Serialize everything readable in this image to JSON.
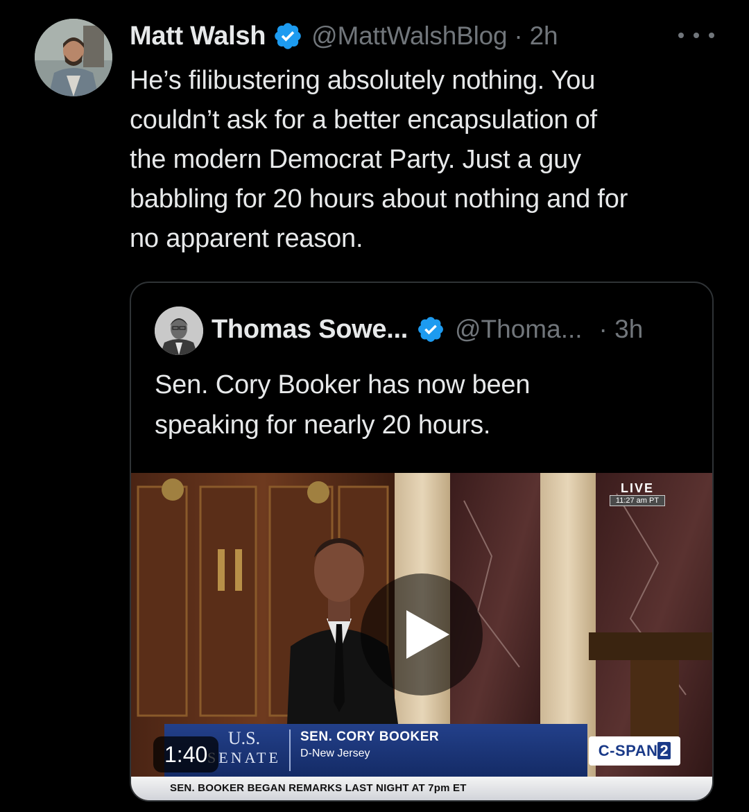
{
  "tweet": {
    "author_name": "Matt Walsh",
    "verified_icon": "verified-badge-icon",
    "handle_time": "@MattWalshBlog · 2h",
    "more_icon": "more-horizontal-icon",
    "body_lines": [
      "He’s filibustering absolutely nothing. You",
      "couldn’t ask for a better encapsulation of",
      "the modern Democrat Party. Just a guy",
      "babbling for 20 hours about nothing and for",
      "no apparent reason."
    ]
  },
  "quote": {
    "author_name": "Thomas Sowe...",
    "verified_icon": "verified-badge-icon",
    "handle": "@Thoma...",
    "time": "· 3h",
    "body_lines": [
      "Sen. Cory Booker has now been",
      "speaking for nearly 20 hours."
    ],
    "video": {
      "live_label": "LIVE",
      "live_time": "11:27 am PT",
      "senate_logo_top": "U.S.",
      "senate_logo_bottom": "SENATE",
      "lower_third_name": "SEN. CORY BOOKER",
      "lower_third_party": "D-New Jersey",
      "ticker": "SEN. BOOKER BEGAN REMARKS LAST NIGHT AT 7pm ET",
      "network_logo": "C-SPAN",
      "network_logo_num": "2",
      "duration": "1:40",
      "play_icon": "play-icon"
    }
  },
  "colors": {
    "background": "#000000",
    "primary_text": "#e7e9ea",
    "secondary_text": "#71767b",
    "verified_blue": "#1d9bf0",
    "border": "#2f3336"
  }
}
